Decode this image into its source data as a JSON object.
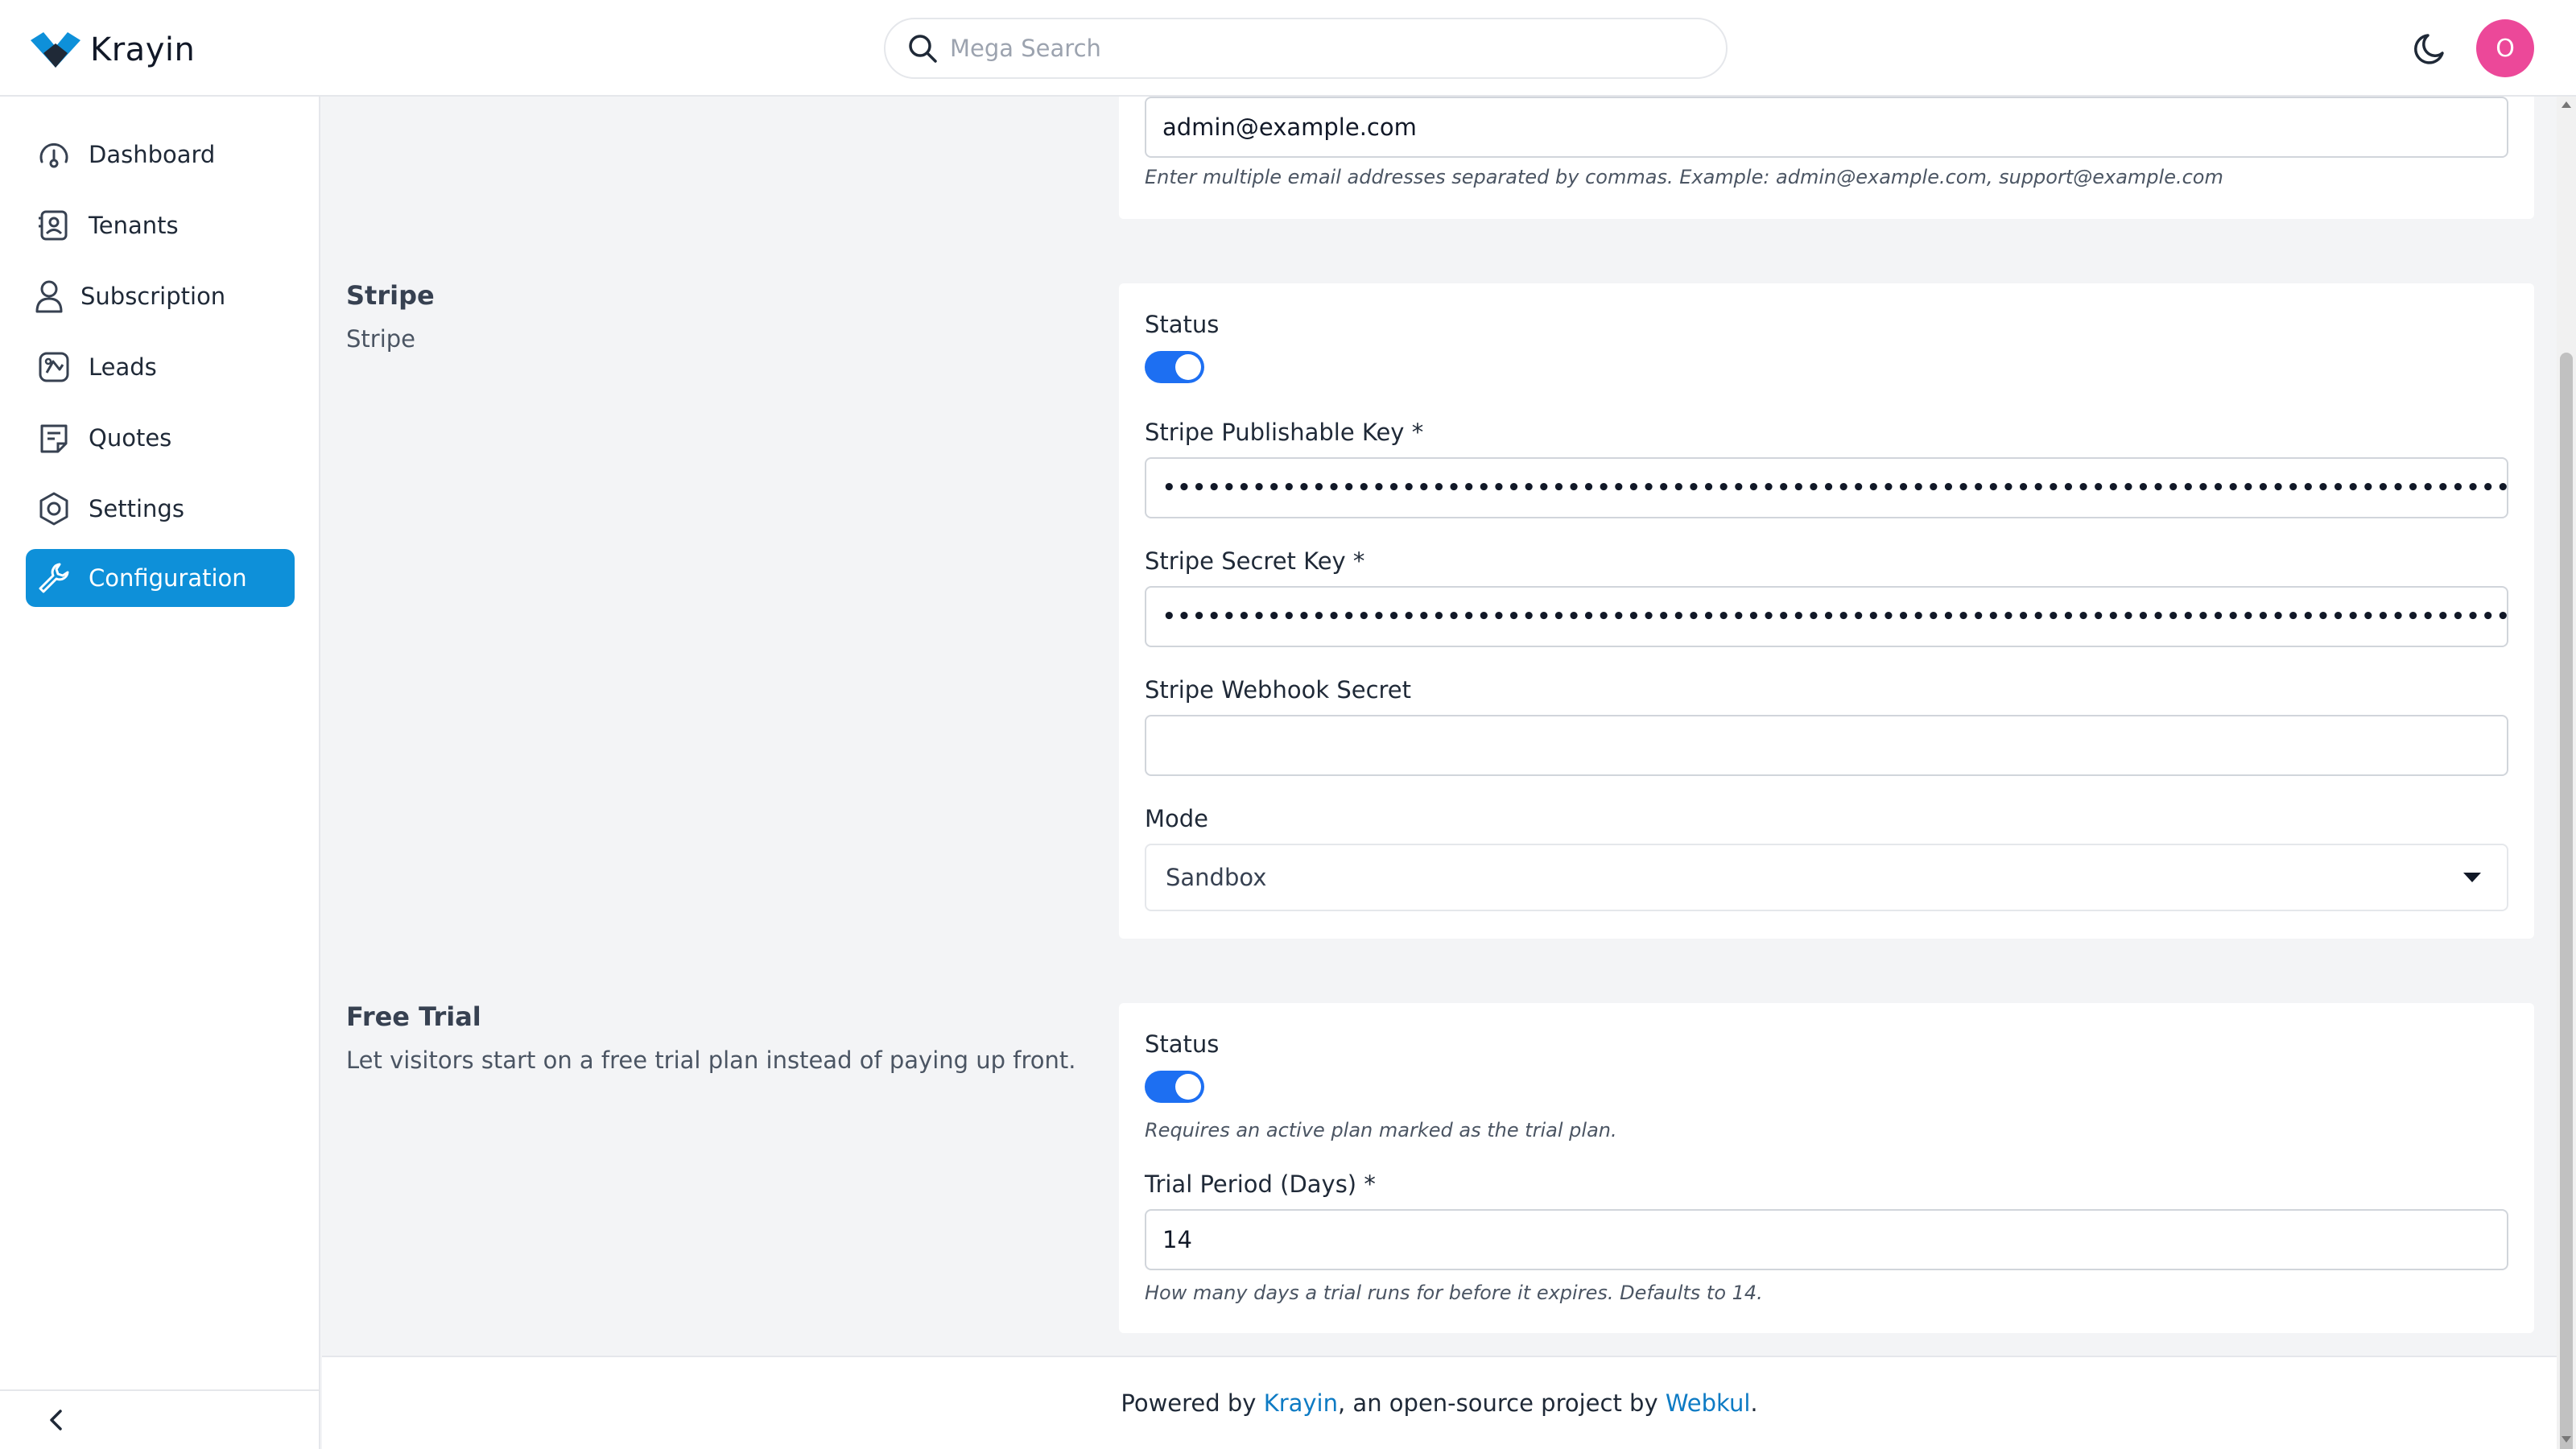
{
  "app": {
    "name": "Krayin"
  },
  "header": {
    "search_placeholder": "Mega Search",
    "avatar_initial": "O"
  },
  "sidebar": {
    "items": [
      {
        "label": "Dashboard",
        "icon": "dashboard-icon"
      },
      {
        "label": "Tenants",
        "icon": "tenants-icon"
      },
      {
        "label": "Subscription",
        "icon": "user-icon"
      },
      {
        "label": "Leads",
        "icon": "leads-icon"
      },
      {
        "label": "Quotes",
        "icon": "quotes-icon"
      },
      {
        "label": "Settings",
        "icon": "settings-icon"
      },
      {
        "label": "Configuration",
        "icon": "wrench-icon",
        "active": true
      }
    ]
  },
  "email_section": {
    "value": "admin@example.com",
    "hint": "Enter multiple email addresses separated by commas. Example: admin@example.com, support@example.com"
  },
  "stripe": {
    "title": "Stripe",
    "description": "Stripe",
    "status_label": "Status",
    "status_enabled": true,
    "publishable_key_label": "Stripe Publishable Key *",
    "publishable_key_value": "••••••••••••••••••••••••••••••••••••••••••••••••••••••••••••••••••••••••••••••••••••••••••••••••••••••••••",
    "secret_key_label": "Stripe Secret Key *",
    "secret_key_value": "••••••••••••••••••••••••••••••••••••••••••••••••••••••••••••••••••••••••••••••••••••••••••••••••••••••••••",
    "webhook_secret_label": "Stripe Webhook Secret",
    "webhook_secret_value": "",
    "mode_label": "Mode",
    "mode_value": "Sandbox"
  },
  "free_trial": {
    "title": "Free Trial",
    "description": "Let visitors start on a free trial plan instead of paying up front.",
    "status_label": "Status",
    "status_enabled": true,
    "status_hint": "Requires an active plan marked as the trial plan.",
    "period_label": "Trial Period (Days) *",
    "period_value": "14",
    "period_hint": "How many days a trial runs for before it expires. Defaults to 14."
  },
  "footer": {
    "prefix": "Powered by ",
    "krayin_link": "Krayin",
    "middle": ", an open-source project by ",
    "webkul_link": "Webkul",
    "suffix": "."
  },
  "colors": {
    "accent": "#0e90d9",
    "toggle_on": "#1d6ff2",
    "avatar": "#ec4899",
    "link": "#0e7bc4"
  }
}
